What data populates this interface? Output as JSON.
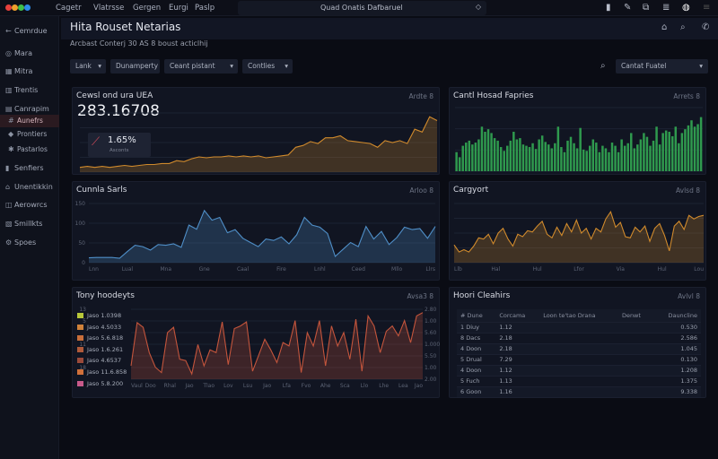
{
  "topbar": {
    "menu": [
      "Cagetr",
      "Vlatrsse",
      "Gergen",
      "Eurgi",
      "Paslp"
    ],
    "search_value": "Quad Onatis Dafbaruel",
    "icons": [
      "bookmark-icon",
      "pen-icon",
      "layers-icon",
      "list-icon",
      "notifications-icon",
      "menu-icon"
    ],
    "dot_colors": [
      "#e8403c",
      "#f0a02c",
      "#3fbf4a",
      "#2d8ce8"
    ]
  },
  "sidebar": {
    "items": [
      {
        "label": "Cemrdue",
        "icon": "back-icon"
      },
      {
        "label": "Mara",
        "icon": "home-icon"
      },
      {
        "label": "Mitra",
        "icon": "grid-icon"
      },
      {
        "label": "Trentis",
        "icon": "chart-icon"
      },
      {
        "label": "Canrapim",
        "icon": "calendar-icon"
      },
      {
        "label": "Aunefrs",
        "icon": "hash-icon",
        "active": true
      },
      {
        "label": "Prontiers",
        "icon": "tag-icon"
      },
      {
        "label": "Pastarlos",
        "icon": "star-icon"
      },
      {
        "label": "Senfiers",
        "icon": "file-icon"
      },
      {
        "label": "Unentikkin",
        "icon": "inbox-icon"
      },
      {
        "label": "Aerowrcs",
        "icon": "box-icon"
      },
      {
        "label": "Smillkts",
        "icon": "doc-icon"
      },
      {
        "label": "Spoes",
        "icon": "settings-icon"
      }
    ]
  },
  "header": {
    "title": "Hita Rouset Netarias",
    "subtitle": "Arcbast Conterj 30 AS 8 boust acticlhij"
  },
  "filters": [
    {
      "label": "Lank",
      "dropdown": true
    },
    {
      "label": "Dunamperty",
      "dropdown": false
    },
    {
      "label": "Ceant pistant",
      "dropdown": true
    },
    {
      "label": "Contlies",
      "dropdown": true
    }
  ],
  "filter_select": {
    "value": "Cantat Fuatel"
  },
  "cards": {
    "revenue": {
      "title": "Cewsl ond ura UEA",
      "meta": "Ardte 8",
      "value": "283.16708",
      "change": "1.65%",
      "change_label": "Asconts"
    },
    "bars": {
      "title": "Cantl Hosad Fapries",
      "meta": "Arrets 8"
    },
    "series": {
      "title": "Cunnla Sarls",
      "meta": "Arloo 8"
    },
    "category": {
      "title": "Cargyort",
      "meta": "Avlsd 8"
    },
    "tony": {
      "title": "Tony hoodeyts",
      "meta": "Avsa3 8"
    },
    "table": {
      "title": "Hoori Cleahirs",
      "meta": "Avlvl 8"
    }
  },
  "chart_data": [
    {
      "type": "area",
      "color": "#d08a2c",
      "values": [
        5,
        6,
        5,
        6,
        5,
        6,
        7,
        6,
        7,
        8,
        8,
        9,
        9,
        12,
        11,
        14,
        16,
        15,
        16,
        16,
        17,
        16,
        17,
        16,
        17,
        15,
        16,
        17,
        18,
        26,
        28,
        32,
        30,
        36,
        36,
        38,
        33,
        32,
        31,
        30,
        26,
        33,
        31,
        33,
        30,
        45,
        42,
        58,
        54
      ],
      "ylim": [
        0,
        62
      ]
    },
    {
      "type": "bar",
      "color": "#2f9a4e",
      "values": [
        30,
        22,
        40,
        45,
        48,
        42,
        45,
        50,
        70,
        62,
        66,
        60,
        52,
        48,
        38,
        32,
        40,
        48,
        62,
        50,
        52,
        42,
        40,
        38,
        44,
        35,
        50,
        56,
        46,
        42,
        36,
        44,
        70,
        38,
        30,
        48,
        54,
        44,
        36,
        68,
        34,
        32,
        40,
        50,
        45,
        30,
        40,
        36,
        30,
        45,
        40,
        30,
        50,
        40,
        44,
        60,
        36,
        42,
        50,
        60,
        54,
        40,
        48,
        70,
        42,
        60,
        64,
        62,
        55,
        70,
        44,
        60,
        66,
        72,
        80,
        70,
        74,
        85
      ],
      "ylim": [
        0,
        100
      ]
    },
    {
      "type": "line",
      "color": "#4f8fc8",
      "x_ticks": [
        "Lnn",
        "Lual",
        "Mna",
        "Gne",
        "Caal",
        "Fire",
        "Lnhl",
        "Ceed",
        "Mllo",
        "Llrs"
      ],
      "y_ticks": [
        "150",
        "100",
        "50",
        "0"
      ],
      "values": [
        14,
        15,
        15,
        15,
        13,
        32,
        50,
        46,
        36,
        52,
        50,
        54,
        44,
        108,
        96,
        150,
        122,
        130,
        86,
        95,
        70,
        58,
        46,
        68,
        64,
        74,
        54,
        80,
        130,
        108,
        102,
        84,
        18,
        38,
        58,
        46,
        104,
        68,
        90,
        52,
        72,
        102,
        95,
        98,
        70,
        104
      ],
      "ylim": [
        0,
        170
      ]
    },
    {
      "type": "area",
      "color": "#d08a2c",
      "x_ticks": [
        "Llb",
        "Hal",
        "Hul",
        "Lfor",
        "Via",
        "Hul",
        "Lou"
      ],
      "values": [
        30,
        18,
        22,
        18,
        28,
        42,
        40,
        48,
        32,
        50,
        58,
        40,
        28,
        48,
        44,
        54,
        52,
        62,
        70,
        48,
        42,
        60,
        46,
        66,
        52,
        72,
        50,
        58,
        40,
        58,
        52,
        74,
        86,
        60,
        68,
        44,
        42,
        60,
        52,
        62,
        36,
        58,
        66,
        46,
        20,
        62,
        70,
        56,
        80,
        74,
        78,
        80
      ],
      "ylim": [
        0,
        100
      ]
    },
    {
      "type": "line",
      "color": "#c4553c",
      "legend": [
        {
          "label": "Jaso 1.0398",
          "color": "#b8c83a"
        },
        {
          "label": "Jaso 4.5033",
          "color": "#d0823a"
        },
        {
          "label": "Jaso 5.6.818",
          "color": "#c86e3a"
        },
        {
          "label": "Jaso 1.6.261",
          "color": "#b05a3a"
        },
        {
          "label": "Jaso 4.6537",
          "color": "#9a4a3a"
        },
        {
          "label": "Jaso 11.6.858",
          "color": "#d0703a"
        },
        {
          "label": "Jaso 5.8.200",
          "color": "#c85a8a"
        }
      ],
      "y_ticks": [
        "13",
        "5",
        "",
        "11",
        "",
        "18",
        ""
      ],
      "right_ticks": [
        "2.80",
        "1.00",
        "5.60",
        "1.000",
        "5.50",
        "1.00",
        "2.00"
      ],
      "x_ticks": [
        "Vaul",
        "Doo",
        "Rhal",
        "Jao",
        "Tlao",
        "Lov",
        "Lsu",
        "Jao",
        "Lfa",
        "Fvo",
        "Ahe",
        "Sca",
        "Llo",
        "Lhe",
        "Lea",
        "Jao"
      ],
      "values": [
        20,
        85,
        78,
        40,
        18,
        10,
        70,
        78,
        30,
        28,
        8,
        52,
        20,
        44,
        40,
        86,
        22,
        76,
        80,
        86,
        12,
        36,
        60,
        44,
        25,
        55,
        50,
        88,
        10,
        70,
        50,
        88,
        20,
        80,
        50,
        70,
        30,
        90,
        12,
        95,
        80,
        40,
        72,
        80,
        65,
        88,
        55,
        95,
        100
      ],
      "ylim": [
        0,
        105
      ]
    }
  ],
  "table": {
    "headers": [
      "# Dune",
      "Corcama",
      "Loon te'tao Drana",
      "Denwt",
      "Dauncline"
    ],
    "rows": [
      [
        "1 Diuy",
        "1.12",
        "",
        "",
        "0.530"
      ],
      [
        "8 Dacs",
        "2.18",
        "",
        "",
        "2.586"
      ],
      [
        "4 Doon",
        "2.18",
        "",
        "",
        "1.045"
      ],
      [
        "5 Drual",
        "7.29",
        "",
        "",
        "0.130"
      ],
      [
        "4 Doon",
        "1.12",
        "",
        "",
        "1.208"
      ],
      [
        "5 Fuch",
        "1.13",
        "",
        "",
        "1.375"
      ],
      [
        "6 Goon",
        "1.16",
        "",
        "",
        "9.338"
      ]
    ]
  }
}
